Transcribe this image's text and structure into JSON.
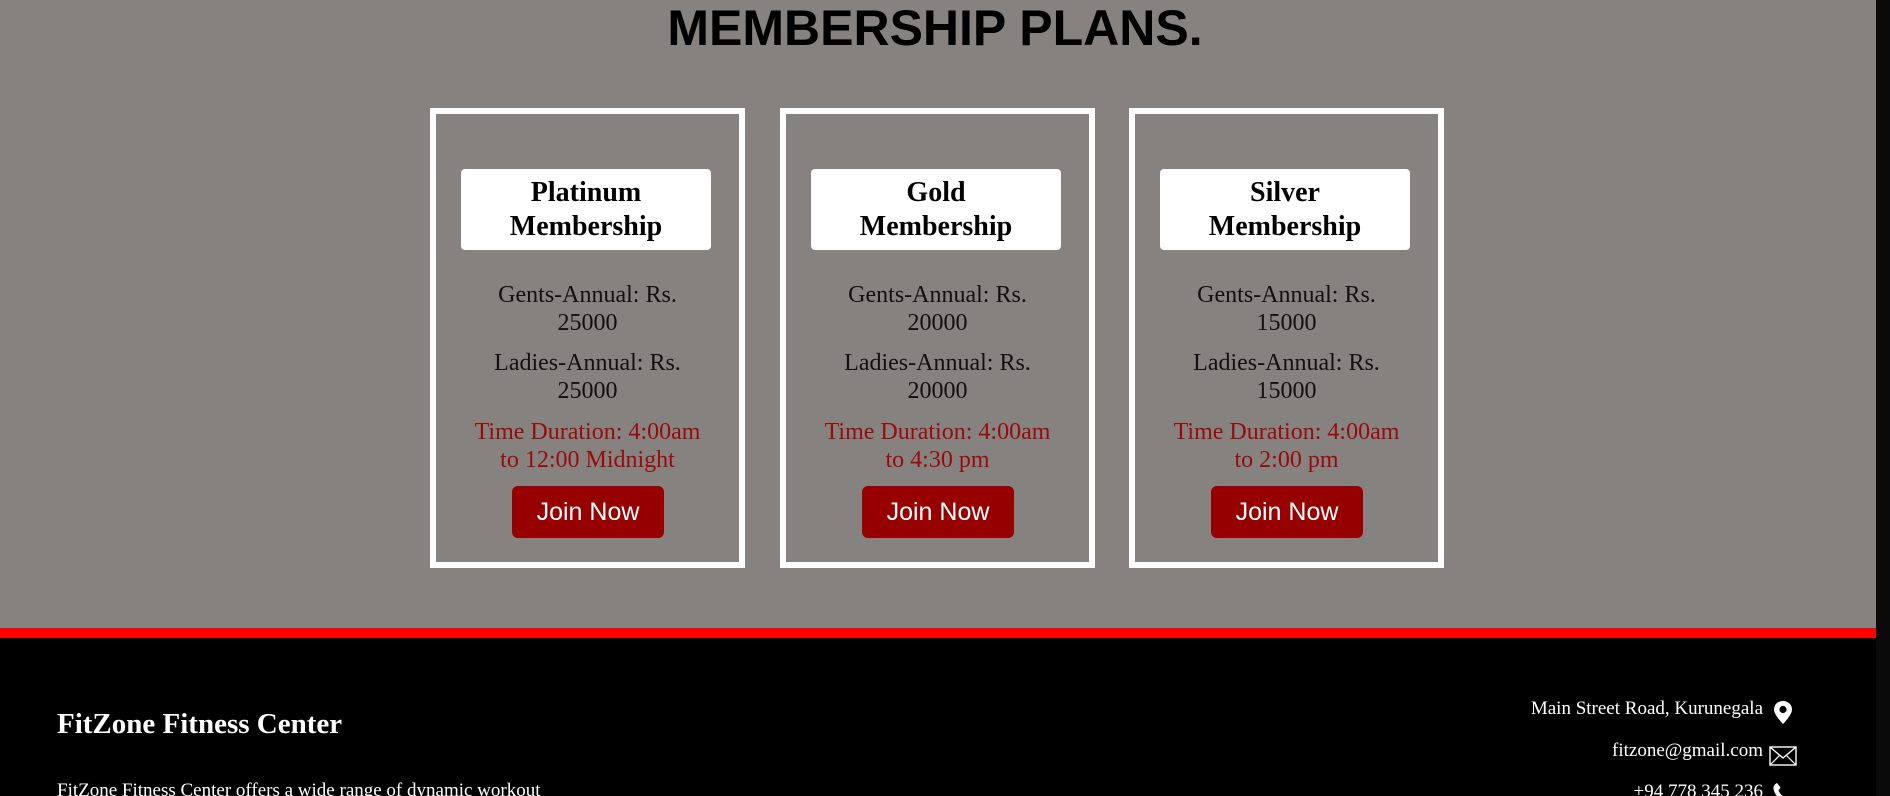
{
  "section": {
    "title": "MEMBERSHIP PLANS."
  },
  "plans": [
    {
      "name_line1": "Platinum",
      "name_line2": "Membership",
      "gents_line1": "Gents-Annual: Rs.",
      "gents_line2": "25000",
      "ladies_line1": "Ladies-Annual: Rs.",
      "ladies_line2": "25000",
      "time_line1": "Time Duration: 4:00am",
      "time_line2": "to 12:00 Midnight",
      "button_label": "Join Now"
    },
    {
      "name_line1": "Gold",
      "name_line2": "Membership",
      "gents_line1": "Gents-Annual: Rs.",
      "gents_line2": "20000",
      "ladies_line1": "Ladies-Annual: Rs.",
      "ladies_line2": "20000",
      "time_line1": "Time Duration: 4:00am",
      "time_line2": "to 4:30 pm",
      "button_label": "Join Now"
    },
    {
      "name_line1": "Silver",
      "name_line2": "Membership",
      "gents_line1": "Gents-Annual: Rs.",
      "gents_line2": "15000",
      "ladies_line1": "Ladies-Annual: Rs.",
      "ladies_line2": "15000",
      "time_line1": "Time Duration: 4:00am",
      "time_line2": "to 2:00 pm",
      "button_label": "Join Now"
    }
  ],
  "footer": {
    "brand": "FitZone Fitness Center",
    "description": "FitZone Fitness Center offers a wide range of dynamic workout",
    "address": "Main Street Road, Kurunegala",
    "email": "fitzone@gmail.com",
    "phone": "+94 778 345 236",
    "icons": {
      "address": "location-pin-icon",
      "email": "envelope-icon",
      "phone": "phone-icon"
    }
  },
  "colors": {
    "section_bg": "#858280",
    "card_border": "#ffffff",
    "button_bg": "#960000",
    "time_text": "#9a0a0a",
    "band": "#ff0000",
    "footer_bg": "#000000"
  }
}
